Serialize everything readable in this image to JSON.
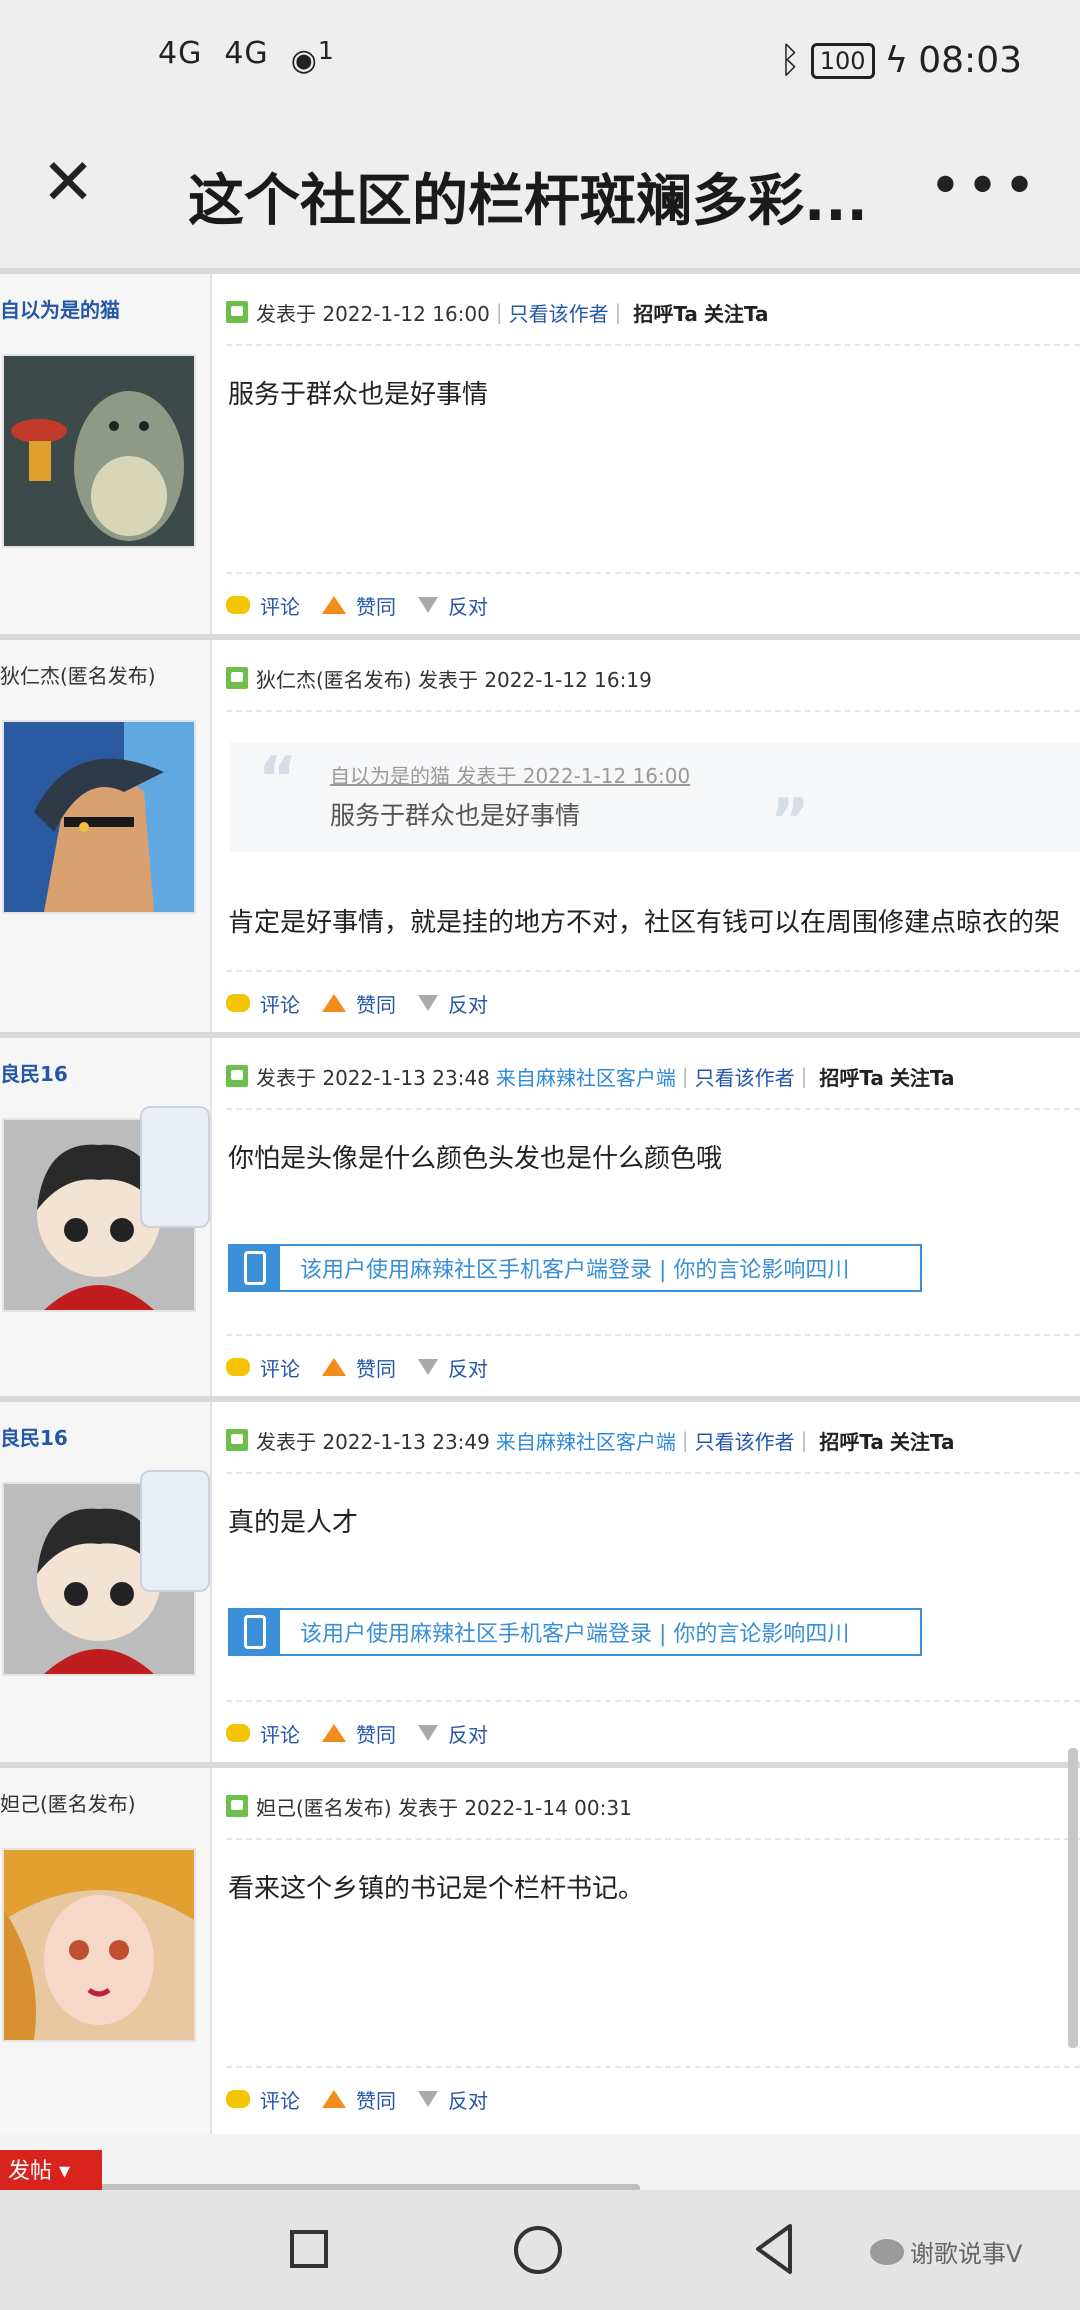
{
  "status_bar": {
    "signal1": "4G",
    "signal2": "4G",
    "wifi_badge": "1",
    "battery": "100",
    "time": "08:03"
  },
  "header": {
    "close_icon": "close-icon",
    "title": "这个社区的栏杆斑斓多彩...",
    "more_icon": "more-icon"
  },
  "labels": {
    "posted_at": "发表于",
    "only_author": "只看该作者",
    "greet": "招呼Ta",
    "follow": "关注Ta",
    "from_client": "来自麻辣社区客户端",
    "comment": "评论",
    "agree": "赞同",
    "oppose": "反对",
    "client_bar": "该用户使用麻辣社区手机客户端登录 | 你的言论影响四川"
  },
  "posts": [
    {
      "author": "自以为是的猫",
      "meta_line": "发表于 2022-1-12 16:00",
      "content": "服务于群众也是好事情"
    },
    {
      "author": "狄仁杰(匿名发布)",
      "meta_line": "狄仁杰(匿名发布) 发表于 2022-1-12 16:19",
      "quote_head": "自以为是的猫 发表于 2022-1-12 16:00",
      "quote_text": "服务于群众也是好事情",
      "content": "肯定是好事情，就是挂的地方不对，社区有钱可以在周围修建点晾衣的架"
    },
    {
      "author": "良民16",
      "meta_line": "发表于 2022-1-13 23:48",
      "content": "你怕是头像是什么颜色头发也是什么颜色哦"
    },
    {
      "author": "良民16",
      "meta_line": "发表于 2022-1-13 23:49",
      "content": "真的是人才"
    },
    {
      "author": "妲己(匿名发布)",
      "meta_line": "妲己(匿名发布) 发表于 2022-1-14 00:31",
      "content": "看来这个乡镇的书记是个栏杆书记。"
    }
  ],
  "bottom": {
    "post_button": "发帖",
    "watermark": "谢歌说事V"
  }
}
